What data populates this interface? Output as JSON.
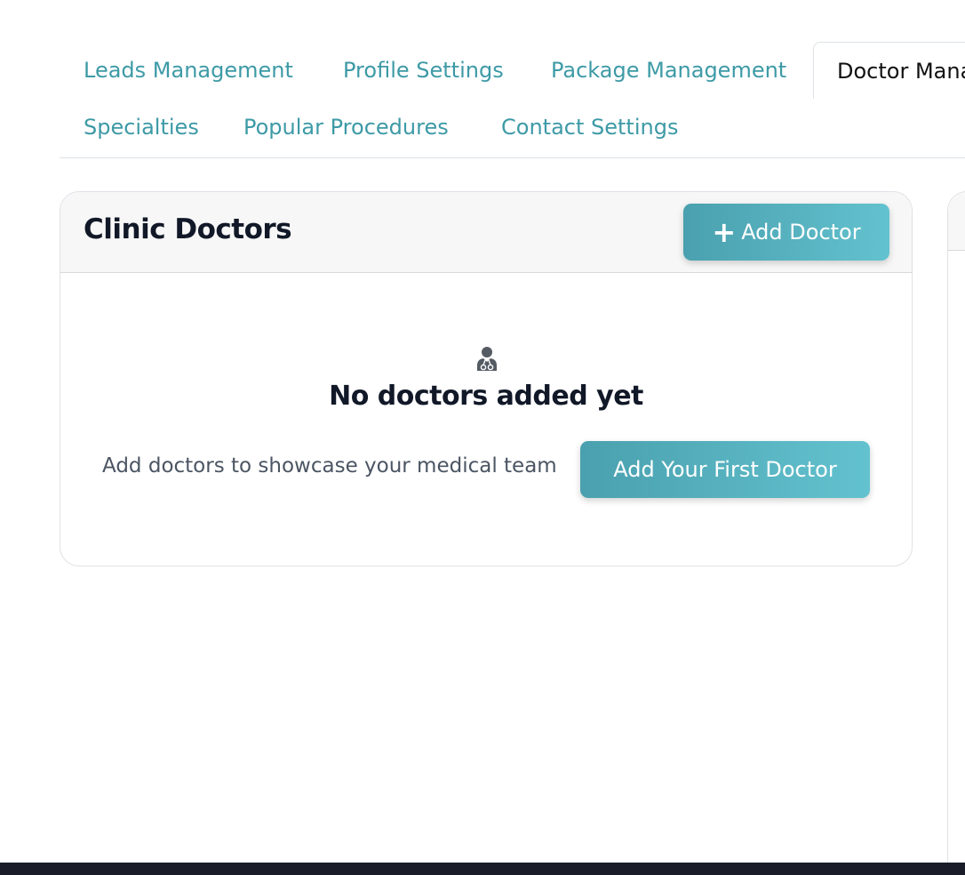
{
  "tabs": [
    {
      "label": "Leads Management",
      "active": false
    },
    {
      "label": "Profile Settings",
      "active": false
    },
    {
      "label": "Package Management",
      "active": false
    },
    {
      "label": "Doctor Mana",
      "active": true
    },
    {
      "label": "Specialties",
      "active": false
    },
    {
      "label": "Popular Procedures",
      "active": false
    },
    {
      "label": "Contact Settings",
      "active": false
    }
  ],
  "card": {
    "title": "Clinic Doctors",
    "add_button_icon": "+",
    "add_button_label": "Add Doctor",
    "empty_icon": "user-doctor-icon",
    "empty_title": "No doctors added yet",
    "empty_description": "Add doctors to showcase your medical team",
    "first_doctor_button_label": "Add Your First Doctor"
  },
  "colors": {
    "tab_link": "#3d9aa6",
    "button_gradient_start": "#4aa0ae",
    "button_gradient_end": "#63c2cf",
    "heading": "#111827",
    "muted_text": "#4b5563",
    "bottom_bar": "#1a1d29"
  }
}
